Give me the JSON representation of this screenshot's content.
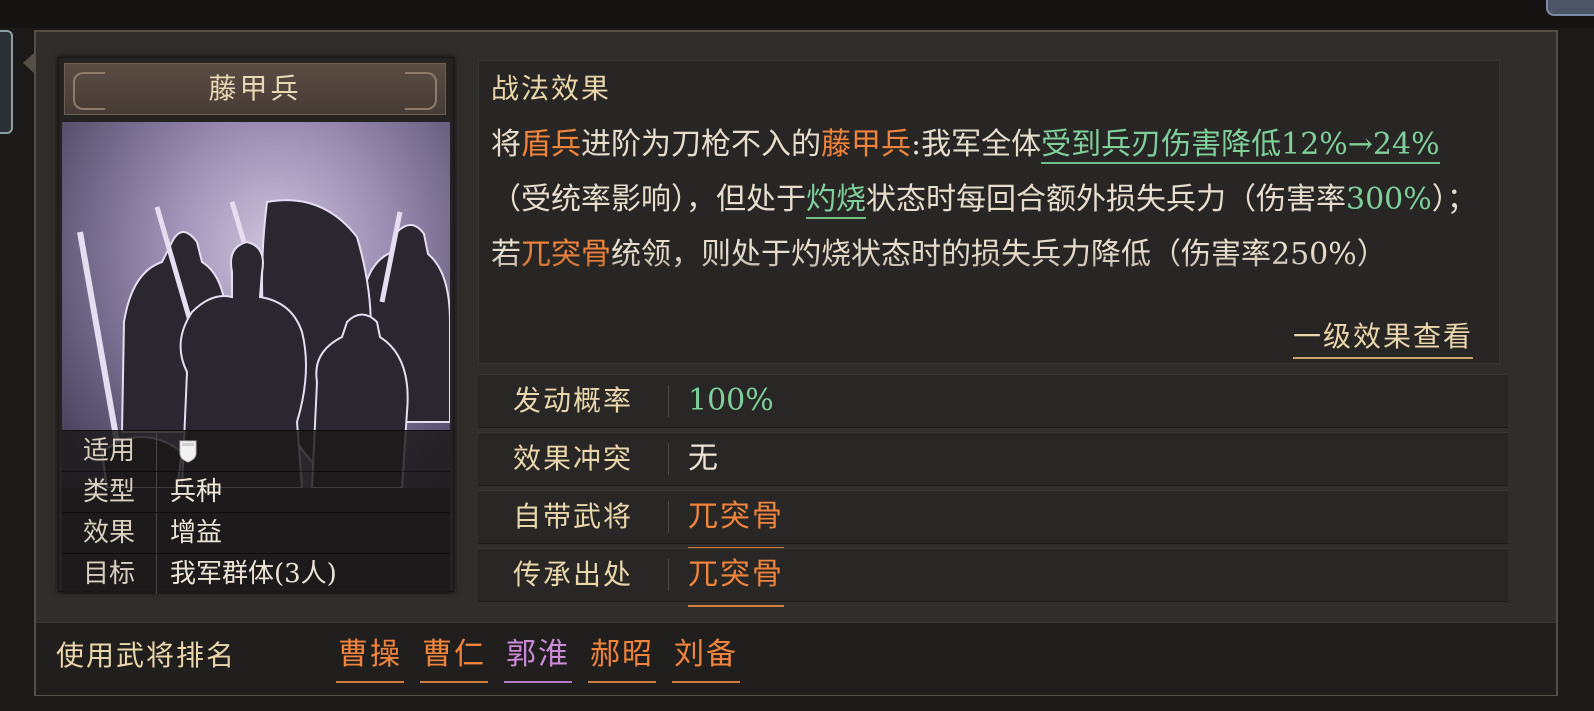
{
  "skill": {
    "name": "藤甲兵",
    "details": [
      {
        "key": "适用",
        "value": "",
        "icon": "shield-icon"
      },
      {
        "key": "类型",
        "value": "兵种"
      },
      {
        "key": "效果",
        "value": "增益"
      },
      {
        "key": "目标",
        "value": "我军群体(3人)"
      }
    ]
  },
  "effect": {
    "title": "战法效果",
    "text": {
      "p1": "将",
      "p2": "盾兵",
      "p3": "进阶为刀枪不入的",
      "p4": "藤甲兵",
      "p5": ":我军全体",
      "p6": "受到兵刃伤害降低12%→24%",
      "p7": "（受统率影响），但处于",
      "p8": "灼烧",
      "p9": "状态时每回合额外损失兵力（伤害率",
      "p10": "300%",
      "p11": "）；若",
      "p12": "兀突骨",
      "p13": "统领，则处于灼烧状态时的损失兵力降低（伤害率250%）"
    },
    "view_level_link": "一级效果查看"
  },
  "info": {
    "trigger_rate": {
      "label": "发动概率",
      "value": "100%"
    },
    "conflict": {
      "label": "效果冲突",
      "value": "无"
    },
    "default_general": {
      "label": "自带武将",
      "value": "兀突骨"
    },
    "inherit_source": {
      "label": "传承出处",
      "value": "兀突骨"
    }
  },
  "ranking": {
    "label": "使用武将排名",
    "names": [
      "曹操",
      "曹仁",
      "郭淮",
      "郝昭",
      "刘备"
    ]
  },
  "colors": {
    "highlight_orange": "#f0843c",
    "highlight_green": "#7fcf9a",
    "label_gold": "#e9d6ab",
    "rank_purple": "#c98ad8"
  }
}
